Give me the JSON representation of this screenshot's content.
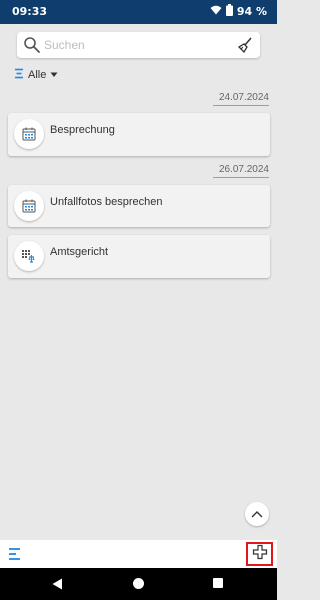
{
  "status": {
    "time": "09:33",
    "battery": "94 %"
  },
  "search": {
    "placeholder": "Suchen"
  },
  "filter": {
    "label": "Alle"
  },
  "groups": [
    {
      "date": "24.07.2024",
      "items": [
        {
          "title": "Besprechung",
          "icon": "calendar-icon"
        }
      ]
    },
    {
      "date": "26.07.2024",
      "items": [
        {
          "title": "Unfallfotos besprechen",
          "icon": "calendar-icon"
        },
        {
          "title": "Amtsgericht",
          "icon": "court-calendar-icon"
        }
      ]
    }
  ],
  "colors": {
    "statusbar": "#0f3e6e",
    "accent": "#1e88e5",
    "highlight": "#e0161a"
  }
}
